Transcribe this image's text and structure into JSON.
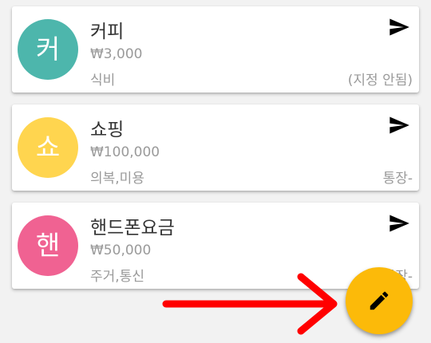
{
  "colors": {
    "fab": "#fcba09",
    "annotation_arrow": "#ff0000",
    "coffee_avatar": "#4db6ac",
    "shopping_avatar": "#ffd54f",
    "phone_avatar": "#f06292"
  },
  "entries": [
    {
      "avatar": "커",
      "title": "커피",
      "amount": "₩3,000",
      "category": "식비",
      "account": "(지정 안됨)",
      "action_icon": "send-icon"
    },
    {
      "avatar": "쇼",
      "title": "쇼핑",
      "amount": "₩100,000",
      "category": "의복,미용",
      "account": "통장-",
      "action_icon": "send-icon"
    },
    {
      "avatar": "핸",
      "title": "핸드폰요금",
      "amount": "₩50,000",
      "category": "주거,통신",
      "account": "통장-",
      "action_icon": "send-icon"
    }
  ],
  "fab": {
    "icon": "pencil-icon"
  },
  "annotation": {
    "icon": "right-arrow-icon"
  }
}
